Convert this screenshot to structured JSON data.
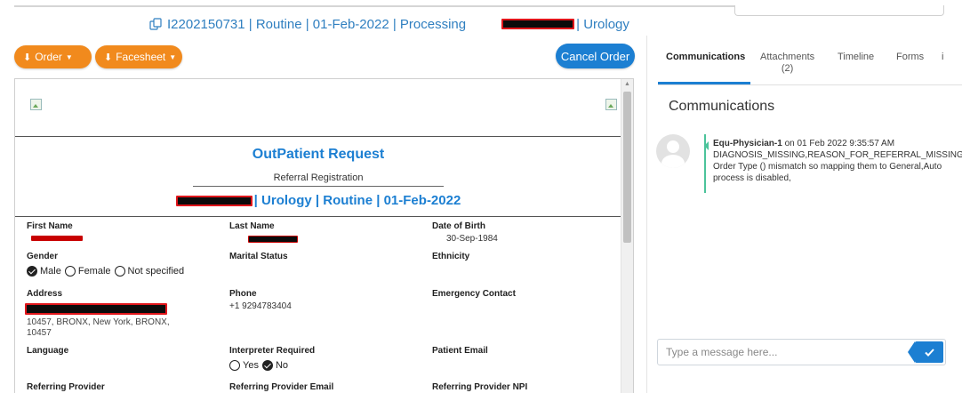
{
  "header": {
    "order_id": "I2202150731",
    "priority": "Routine",
    "date": "01-Feb-2022",
    "status": "Processing",
    "department": "Urology"
  },
  "toolbar": {
    "order_label": "Order",
    "facesheet_label": "Facesheet",
    "cancel_label": "Cancel Order"
  },
  "document": {
    "title": "OutPatient Request",
    "subtitle": "Referral Registration",
    "title_line": "| Urology | Routine | 01-Feb-2022",
    "fields": {
      "first_name_label": "First Name",
      "last_name_label": "Last Name",
      "dob_label": "Date of Birth",
      "dob_value": "30-Sep-1984",
      "gender_label": "Gender",
      "gender_options": [
        "Male",
        "Female",
        "Not specified"
      ],
      "gender_selected": "Male",
      "marital_label": "Marital Status",
      "ethnicity_label": "Ethnicity",
      "address_label": "Address",
      "address_value": "10457, BRONX, New York, BRONX, 10457",
      "phone_label": "Phone",
      "phone_value": "+1 9294783404",
      "emergency_label": "Emergency Contact",
      "language_label": "Language",
      "interpreter_label": "Interpreter Required",
      "interpreter_options": [
        "Yes",
        "No"
      ],
      "interpreter_selected": "No",
      "patient_email_label": "Patient Email",
      "ref_provider_label": "Referring Provider",
      "ref_provider_email_label": "Referring Provider Email",
      "ref_provider_npi_label": "Referring Provider NPI"
    }
  },
  "panel": {
    "tabs": [
      "Communications",
      "Attachments\n(2)",
      "Timeline",
      "Forms",
      "i"
    ],
    "active_tab": "Communications",
    "heading": "Communications",
    "messages": [
      {
        "author": "Equ-Physician-1",
        "meta": " on 01 Feb 2022 9:35:57 AM",
        "text": "DIAGNOSIS_MISSING,REASON_FOR_REFERRAL_MISSING, Order Type () mismatch so mapping them to General,Auto process is disabled,"
      }
    ],
    "input_placeholder": "Type a message here...",
    "send_icon": "check-icon"
  },
  "colors": {
    "brand_blue": "#1c7fd2",
    "orange": "#f18a1d",
    "message_accent": "#4cc39b",
    "redaction": "#0b0b0b"
  }
}
